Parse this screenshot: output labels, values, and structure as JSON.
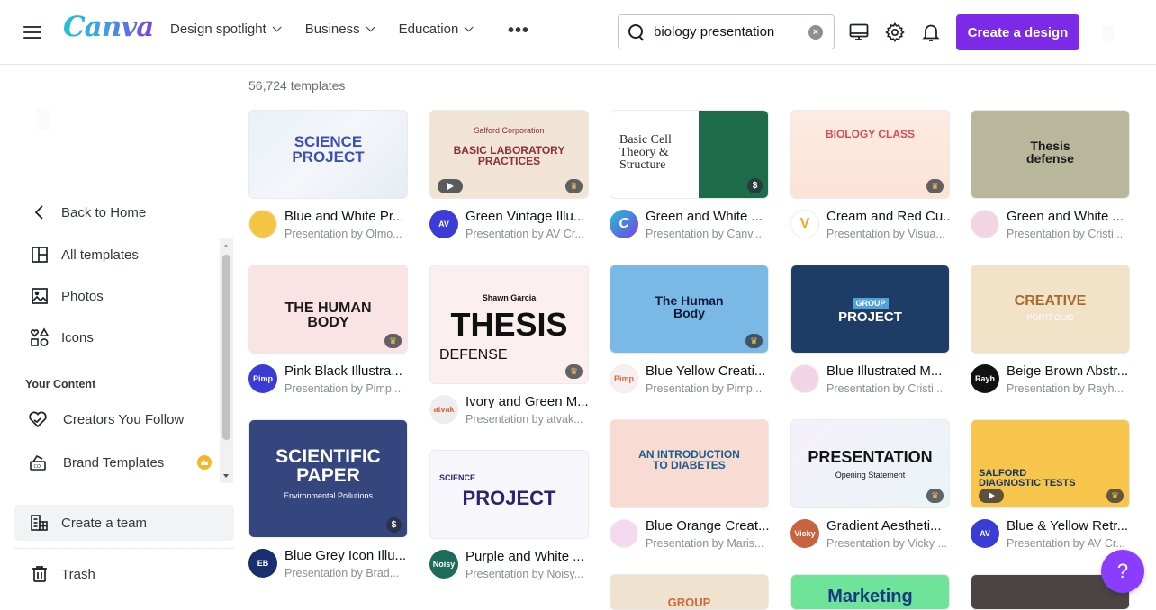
{
  "header": {
    "logo": "Canva",
    "nav": [
      {
        "label": "Design spotlight"
      },
      {
        "label": "Business"
      },
      {
        "label": "Education"
      }
    ],
    "more_label": "•••",
    "search": {
      "value": "biology presentation",
      "clear_icon": "×"
    },
    "create_button": "Create a design",
    "accent_color": "#7d2ae8"
  },
  "sidebar": {
    "back": "Back to Home",
    "items": [
      {
        "label": "All templates",
        "icon": "layout-icon"
      },
      {
        "label": "Photos",
        "icon": "image-icon"
      },
      {
        "label": "Icons",
        "icon": "shapes-icon"
      }
    ],
    "section_title": "Your Content",
    "content_items": [
      {
        "label": "Creators You Follow",
        "icon": "heart-icon"
      },
      {
        "label": "Brand Templates",
        "icon": "brand-kit-icon",
        "premium": true
      }
    ],
    "create_team": "Create a team",
    "trash": "Trash"
  },
  "main": {
    "count": "56,724 templates",
    "columns": [
      [
        {
          "name": "Blue and White Pr...",
          "by": "Presentation by Olmo...",
          "thumb_title": "SCIENCE\nPROJECT",
          "avatar_text": "",
          "badge": ""
        },
        {
          "name": "Pink Black Illustra...",
          "by": "Presentation by Pimp...",
          "thumb_title": "THE HUMAN\nBODY",
          "avatar_text": "Pimp",
          "badge": "crown"
        },
        {
          "name": "Blue Grey Icon Illu...",
          "by": "Presentation by Brad...",
          "thumb_title": "SCIENTIFIC\nPAPER",
          "thumb_sub": "Environmental Pollutions",
          "avatar_text": "EB",
          "badge": "$"
        }
      ],
      [
        {
          "name": "Green Vintage Illu...",
          "by": "Presentation by AV Cr...",
          "thumb_title": "BASIC LABORATORY\nPRACTICES",
          "thumb_sub": "Salford Corporation",
          "avatar_text": "AV",
          "badge": "crown",
          "video": true
        },
        {
          "name": "Ivory and Green M...",
          "by": "Presentation by atvak...",
          "thumb_title": "THESIS",
          "thumb_sub": "DEFENSE",
          "thumb_tag": "Shawn Garcia",
          "avatar_text": "atvak",
          "badge": "crown"
        },
        {
          "name": "Purple and White ...",
          "by": "Presentation by Noisy...",
          "thumb_title": "PROJECT",
          "thumb_sub": "SCIENCE",
          "avatar_text": "Noisy",
          "badge": ""
        }
      ],
      [
        {
          "name": "Green and White ...",
          "by": "Presentation by Canv...",
          "thumb_title": "Basic Cell\nTheory &\nStructure",
          "avatar_text": "C",
          "badge": "$"
        },
        {
          "name": "Blue Yellow Creati...",
          "by": "Presentation by Pimp...",
          "thumb_title": "The Human\nBody",
          "avatar_text": "Pimp",
          "badge": "crown"
        },
        {
          "name": "Blue Orange Creat...",
          "by": "Presentation by Maris...",
          "thumb_title": "AN INTRODUCTION\nTO DIABETES",
          "avatar_text": "",
          "badge": ""
        },
        {
          "thumb_title": "GROUP"
        }
      ],
      [
        {
          "name": "Cream and Red Cu...",
          "by": "Presentation by Visua...",
          "thumb_title": "BIOLOGY CLASS",
          "avatar_text": "V",
          "badge": "crown"
        },
        {
          "name": "Blue Illustrated M...",
          "by": "Presentation by Cristi...",
          "thumb_title": "PROJECT",
          "thumb_tag": "GROUP",
          "avatar_text": "",
          "badge": ""
        },
        {
          "name": "Gradient Aestheti...",
          "by": "Presentation by Vicky ...",
          "thumb_title": "PRESENTATION",
          "thumb_sub": "Opening Statement",
          "avatar_text": "Vicky",
          "badge": "crown"
        },
        {
          "thumb_title": "Marketing"
        }
      ],
      [
        {
          "name": "Green and White ...",
          "by": "Presentation by Cristi...",
          "thumb_title": "Thesis\ndefense",
          "avatar_text": "",
          "badge": ""
        },
        {
          "name": "Beige Brown Abstr...",
          "by": "Presentation by Rayh...",
          "thumb_title": "CREATIVE",
          "thumb_sub": "PORTFOLIO",
          "avatar_text": "Rayh",
          "badge": ""
        },
        {
          "name": "Blue & Yellow Retr...",
          "by": "Presentation by AV Cr...",
          "thumb_title": "SALFORD\nDIAGNOSTIC TESTS",
          "avatar_text": "AV",
          "badge": "crown",
          "video": true
        },
        {
          "thumb_title": ""
        }
      ]
    ]
  },
  "help_label": "?"
}
